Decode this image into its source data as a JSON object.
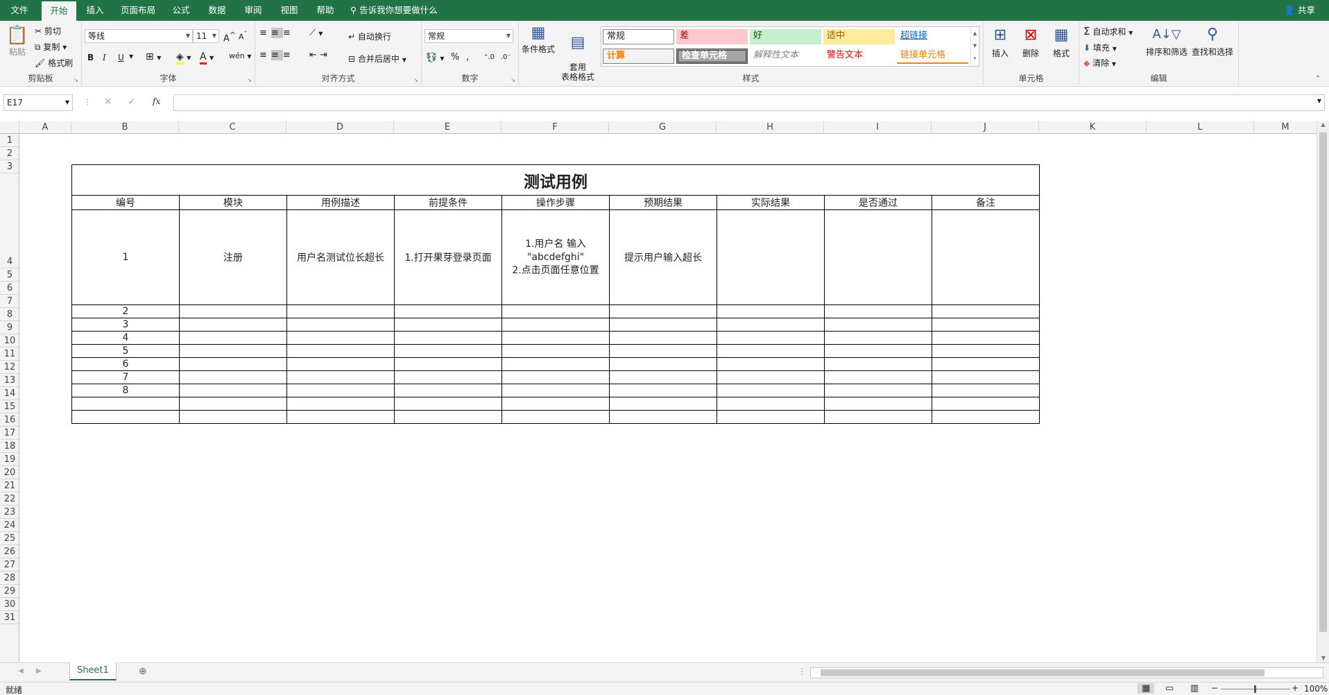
{
  "menu": {
    "tabs": [
      "文件",
      "开始",
      "插入",
      "页面布局",
      "公式",
      "数据",
      "审阅",
      "视图",
      "帮助"
    ],
    "active_tab": "开始",
    "tell_me": "告诉我你想要做什么",
    "share": "共享"
  },
  "ribbon": {
    "clipboard": {
      "paste": "粘贴",
      "cut": "剪切",
      "copy": "复制",
      "format_painter": "格式刷",
      "label": "剪贴板"
    },
    "font": {
      "name": "等线",
      "size": "11",
      "bold": "B",
      "italic": "I",
      "underline": "U",
      "label": "字体"
    },
    "align": {
      "wrap": "自动换行",
      "merge": "合并后居中",
      "label": "对齐方式"
    },
    "number": {
      "format": "常规",
      "percent": "%",
      "comma": ",",
      "label": "数字"
    },
    "styles": {
      "conditional": "条件格式",
      "table": "套用\n表格格式",
      "cells": [
        {
          "text": "常规",
          "color": "#000000",
          "bg": "#ffffff"
        },
        {
          "text": "差",
          "color": "#9c0006",
          "bg": "#ffc7ce"
        },
        {
          "text": "好",
          "color": "#006100",
          "bg": "#c6efce"
        },
        {
          "text": "适中",
          "color": "#9c5700",
          "bg": "#ffeb9c"
        },
        {
          "text": "超链接",
          "color": "#0563c1",
          "bg": "#ffffff"
        },
        {
          "text": "计算",
          "color": "#fa7d00",
          "bg": "#f2f2f2"
        },
        {
          "text": "检查单元格",
          "color": "#ffffff",
          "bg": "#a5a5a5"
        },
        {
          "text": "解释性文本",
          "color": "#7f7f7f",
          "bg": "#ffffff"
        },
        {
          "text": "警告文本",
          "color": "#ff0000",
          "bg": "#ffffff"
        },
        {
          "text": "链接单元格",
          "color": "#fa7d00",
          "bg": "#ffffff"
        }
      ],
      "label": "样式"
    },
    "cells": {
      "insert": "插入",
      "delete": "删除",
      "format": "格式",
      "label": "单元格"
    },
    "editing": {
      "autosum": "自动求和",
      "fill": "填充",
      "clear": "清除",
      "sort": "排序和筛选",
      "find": "查找和选择",
      "label": "编辑"
    }
  },
  "formula_bar": {
    "name_box": "E17",
    "fx": "fx",
    "value": ""
  },
  "columns": [
    "A",
    "B",
    "C",
    "D",
    "E",
    "F",
    "G",
    "H",
    "I",
    "J",
    "K",
    "L",
    "M"
  ],
  "rows": [
    "1",
    "2",
    "3",
    "4",
    "5",
    "6",
    "7",
    "8",
    "9",
    "10",
    "11",
    "12",
    "13",
    "14",
    "15",
    "16",
    "17",
    "18",
    "19",
    "20",
    "21",
    "22",
    "23",
    "24",
    "25",
    "26",
    "27",
    "28",
    "29",
    "30",
    "31"
  ],
  "table": {
    "title": "测试用例",
    "headers": [
      "编号",
      "模块",
      "用例描述",
      "前提条件",
      "操作步骤",
      "预期结果",
      "实际结果",
      "是否通过",
      "备注"
    ],
    "first_row": {
      "id": "1",
      "module": "注册",
      "desc": "用户名测试位长超长",
      "precondition": "1.打开果芽登录页面",
      "steps_l1": "1.用户名 输入",
      "steps_l2": "\"abcdefghi\"",
      "steps_l3": "2.点击页面任意位置",
      "expected": "提示用户输入超长",
      "actual": "",
      "pass": "",
      "note": ""
    },
    "ids": [
      "2",
      "3",
      "4",
      "5",
      "6",
      "7",
      "8",
      "",
      ""
    ]
  },
  "sheet_tab": "Sheet1",
  "status": {
    "ready": "就绪",
    "zoom": "100%"
  }
}
